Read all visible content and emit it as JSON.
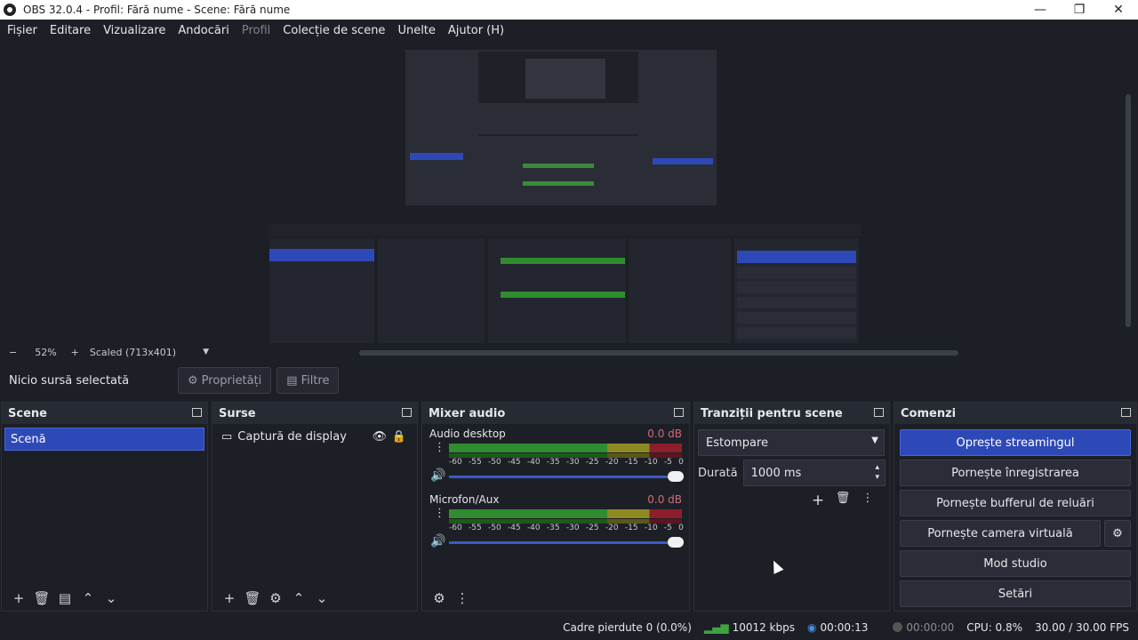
{
  "window": {
    "title": "OBS 32.0.4 - Profil: Fără nume - Scene: Fără nume",
    "controls": {
      "minimize": "—",
      "maximize": "❐",
      "close": "✕"
    }
  },
  "menu": {
    "items": [
      "Fișier",
      "Editare",
      "Vizualizare",
      "Andocări",
      "Profil",
      "Colecție de scene",
      "Unelte",
      "Ajutor (H)"
    ]
  },
  "zoom": {
    "minus": "−",
    "value": "52%",
    "plus": "+",
    "scale": "Scaled (713x401)",
    "dropdown_icon": "▼"
  },
  "source_toolbar": {
    "no_selection": "Nicio sursă selectată",
    "properties_label": "Proprietăți",
    "filters_label": "Filtre"
  },
  "docks": {
    "scenes": {
      "title": "Scene",
      "items": [
        "Scenă"
      ]
    },
    "sources": {
      "title": "Surse",
      "items": [
        "Captură de display"
      ]
    },
    "mixer": {
      "title": "Mixer audio",
      "channels": [
        {
          "name": "Audio desktop",
          "db": "0.0 dB"
        },
        {
          "name": "Microfon/Aux",
          "db": "0.0 dB"
        }
      ],
      "ticks": [
        "-60",
        "-55",
        "-50",
        "-45",
        "-40",
        "-35",
        "-30",
        "-25",
        "-20",
        "-15",
        "-10",
        "-5",
        "0"
      ]
    },
    "transitions": {
      "title": "Tranziții pentru scene",
      "transition": "Estompare",
      "duration_label": "Durată",
      "duration_value": "1000 ms"
    },
    "controls": {
      "title": "Comenzi",
      "buttons": [
        "Oprește streamingul",
        "Pornește înregistrarea",
        "Pornește bufferul de reluări",
        "Pornește camera virtuală",
        "Mod studio",
        "Setări"
      ]
    }
  },
  "status": {
    "dropped_frames": "Cadre pierdute 0 (0.0%)",
    "bitrate": "10012 kbps",
    "stream_time": "00:00:13",
    "record_time": "00:00:00",
    "cpu": "CPU: 0.8%",
    "fps": "30.00 / 30.00 FPS"
  },
  "colors": {
    "accent": "#2d49b8",
    "background": "#1d1f26",
    "panel": "#262a33"
  }
}
